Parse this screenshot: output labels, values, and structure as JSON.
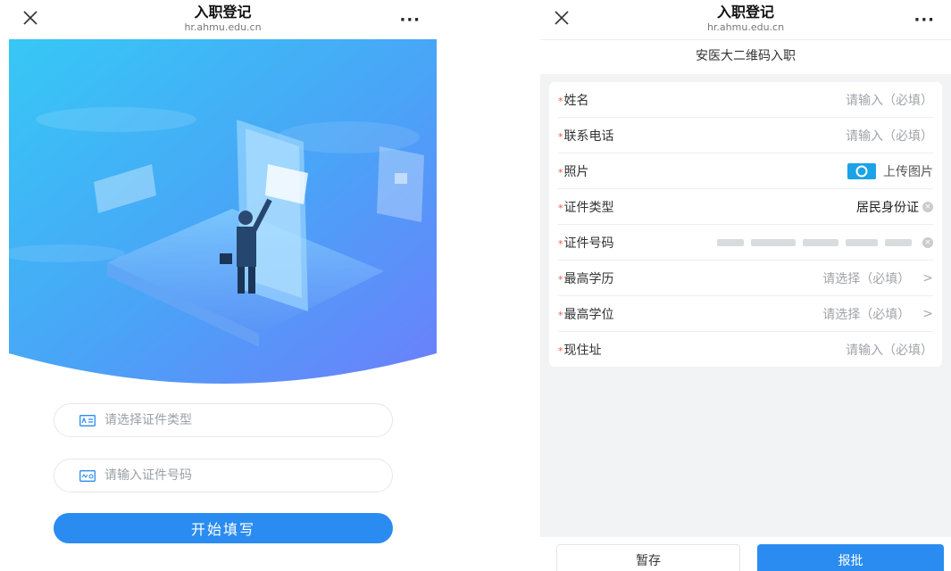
{
  "left": {
    "titlebar": {
      "title": "入职登记",
      "url": "hr.ahmu.edu.cn",
      "more": "···"
    },
    "id_type_placeholder": "请选择证件类型",
    "id_number_placeholder": "请输入证件号码",
    "start_button": "开始填写"
  },
  "right": {
    "titlebar": {
      "title": "入职登记",
      "url": "hr.ahmu.edu.cn",
      "more": "···"
    },
    "subheader": "安医大二维码入职",
    "fields": {
      "name": {
        "label": "姓名",
        "value": "请输入（必填）"
      },
      "phone": {
        "label": "联系电话",
        "value": "请输入（必填）"
      },
      "photo": {
        "label": "照片",
        "value": "上传图片"
      },
      "id_type": {
        "label": "证件类型",
        "value": "居民身份证"
      },
      "id_number": {
        "label": "证件号码",
        "value": ""
      },
      "education": {
        "label": "最高学历",
        "value": "请选择（必填）"
      },
      "degree": {
        "label": "最高学位",
        "value": "请选择（必填）"
      },
      "address": {
        "label": "现住址",
        "value": "请输入（必填）"
      }
    },
    "required_mark": "*",
    "arrow": ">",
    "save_button": "暂存",
    "submit_button": "报批"
  },
  "colors": {
    "primary": "#2a8cf0",
    "required": "#f5574b",
    "hero_top": "#38c6f4",
    "hero_bottom": "#6a7dfb"
  }
}
